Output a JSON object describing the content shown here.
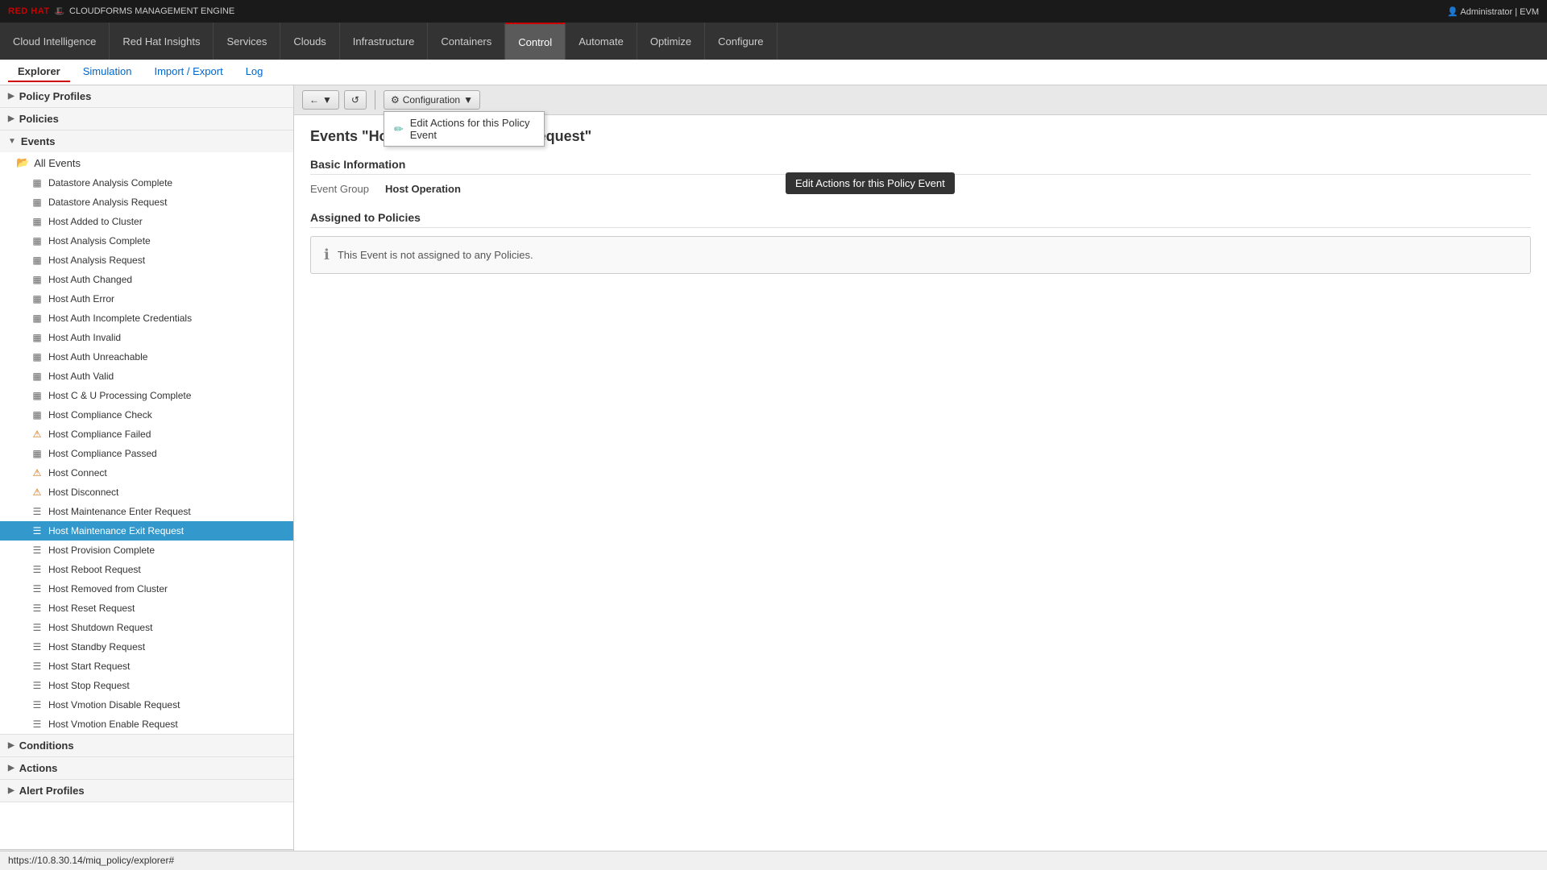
{
  "app": {
    "brand": "RED HAT",
    "brand_sub": "CLOUDFORMS MANAGEMENT ENGINE",
    "user": "Administrator | EVM"
  },
  "nav": {
    "items": [
      {
        "id": "cloud-intelligence",
        "label": "Cloud Intelligence",
        "active": false
      },
      {
        "id": "red-hat-insights",
        "label": "Red Hat Insights",
        "active": false
      },
      {
        "id": "services",
        "label": "Services",
        "active": false
      },
      {
        "id": "clouds",
        "label": "Clouds",
        "active": false
      },
      {
        "id": "infrastructure",
        "label": "Infrastructure",
        "active": false
      },
      {
        "id": "containers",
        "label": "Containers",
        "active": false
      },
      {
        "id": "control",
        "label": "Control",
        "active": true
      },
      {
        "id": "automate",
        "label": "Automate",
        "active": false
      },
      {
        "id": "optimize",
        "label": "Optimize",
        "active": false
      },
      {
        "id": "configure",
        "label": "Configure",
        "active": false
      }
    ]
  },
  "sub_nav": {
    "items": [
      {
        "id": "explorer",
        "label": "Explorer",
        "active": true
      },
      {
        "id": "simulation",
        "label": "Simulation",
        "active": false
      },
      {
        "id": "import-export",
        "label": "Import / Export",
        "active": false
      },
      {
        "id": "log",
        "label": "Log",
        "active": false
      }
    ]
  },
  "sidebar": {
    "sections": [
      {
        "id": "policy-profiles",
        "label": "Policy Profiles",
        "expanded": false
      },
      {
        "id": "policies",
        "label": "Policies",
        "expanded": false
      },
      {
        "id": "events",
        "label": "Events",
        "expanded": true
      }
    ],
    "events_group": "All Events",
    "tree_items": [
      {
        "id": "datastore-analysis-complete",
        "label": "Datastore Analysis Complete",
        "icon": "grid",
        "selected": false
      },
      {
        "id": "datastore-analysis-request",
        "label": "Datastore Analysis Request",
        "icon": "grid",
        "selected": false
      },
      {
        "id": "host-added-to-cluster",
        "label": "Host Added to Cluster",
        "icon": "grid",
        "selected": false
      },
      {
        "id": "host-analysis-complete",
        "label": "Host Analysis Complete",
        "icon": "grid",
        "selected": false
      },
      {
        "id": "host-analysis-request",
        "label": "Host Analysis Request",
        "icon": "grid",
        "selected": false
      },
      {
        "id": "host-auth-changed",
        "label": "Host Auth Changed",
        "icon": "grid",
        "selected": false
      },
      {
        "id": "host-auth-error",
        "label": "Host Auth Error",
        "icon": "grid",
        "selected": false
      },
      {
        "id": "host-auth-incomplete-credentials",
        "label": "Host Auth Incomplete Credentials",
        "icon": "grid",
        "selected": false
      },
      {
        "id": "host-auth-invalid",
        "label": "Host Auth Invalid",
        "icon": "grid",
        "selected": false
      },
      {
        "id": "host-auth-unreachable",
        "label": "Host Auth Unreachable",
        "icon": "grid",
        "selected": false
      },
      {
        "id": "host-auth-valid",
        "label": "Host Auth Valid",
        "icon": "grid",
        "selected": false
      },
      {
        "id": "host-c-u-processing-complete",
        "label": "Host C & U Processing Complete",
        "icon": "grid",
        "selected": false
      },
      {
        "id": "host-compliance-check",
        "label": "Host Compliance Check",
        "icon": "grid",
        "selected": false
      },
      {
        "id": "host-compliance-failed",
        "label": "Host Compliance Failed",
        "icon": "warning",
        "selected": false
      },
      {
        "id": "host-compliance-passed",
        "label": "Host Compliance Passed",
        "icon": "grid",
        "selected": false
      },
      {
        "id": "host-connect",
        "label": "Host Connect",
        "icon": "warning",
        "selected": false
      },
      {
        "id": "host-disconnect",
        "label": "Host Disconnect",
        "icon": "warning",
        "selected": false
      },
      {
        "id": "host-maintenance-enter-request",
        "label": "Host Maintenance Enter Request",
        "icon": "lines",
        "selected": false
      },
      {
        "id": "host-maintenance-exit-request",
        "label": "Host Maintenance Exit Request",
        "icon": "lines",
        "selected": true
      },
      {
        "id": "host-provision-complete",
        "label": "Host Provision Complete",
        "icon": "lines",
        "selected": false
      },
      {
        "id": "host-reboot-request",
        "label": "Host Reboot Request",
        "icon": "lines",
        "selected": false
      },
      {
        "id": "host-removed-from-cluster",
        "label": "Host Removed from Cluster",
        "icon": "lines",
        "selected": false
      },
      {
        "id": "host-reset-request",
        "label": "Host Reset Request",
        "icon": "lines",
        "selected": false
      },
      {
        "id": "host-shutdown-request",
        "label": "Host Shutdown Request",
        "icon": "lines",
        "selected": false
      },
      {
        "id": "host-standby-request",
        "label": "Host Standby Request",
        "icon": "lines",
        "selected": false
      },
      {
        "id": "host-start-request",
        "label": "Host Start Request",
        "icon": "lines",
        "selected": false
      },
      {
        "id": "host-stop-request",
        "label": "Host Stop Request",
        "icon": "lines",
        "selected": false
      },
      {
        "id": "host-vmotion-disable-request",
        "label": "Host Vmotion Disable Request",
        "icon": "lines",
        "selected": false
      },
      {
        "id": "host-vmotion-enable-request",
        "label": "Host Vmotion Enable Request",
        "icon": "lines",
        "selected": false
      }
    ],
    "bottom_sections": [
      {
        "id": "conditions",
        "label": "Conditions",
        "expanded": false
      },
      {
        "id": "actions",
        "label": "Actions",
        "expanded": false
      },
      {
        "id": "alert-profiles",
        "label": "Alert Profiles",
        "expanded": false
      }
    ]
  },
  "toolbar": {
    "back_label": "←",
    "refresh_label": "↺",
    "configuration_label": "Configuration",
    "configuration_arrow": "▼"
  },
  "dropdown": {
    "items": [
      {
        "id": "edit-actions",
        "label": "Edit Actions for this Policy Event",
        "icon": "✏️"
      }
    ]
  },
  "tooltip": {
    "text": "Edit Actions for this Policy Event"
  },
  "content": {
    "title": "Events \"Host Maintenance Exit Request\"",
    "basic_info_title": "Basic Information",
    "event_group_label": "Event Group",
    "event_group_value": "Host Operation",
    "assigned_policies_title": "Assigned to Policies",
    "no_policies_message": "This Event is not assigned to any Policies."
  },
  "status_bar": {
    "url": "https://10.8.30.14/miq_policy/explorer#"
  }
}
